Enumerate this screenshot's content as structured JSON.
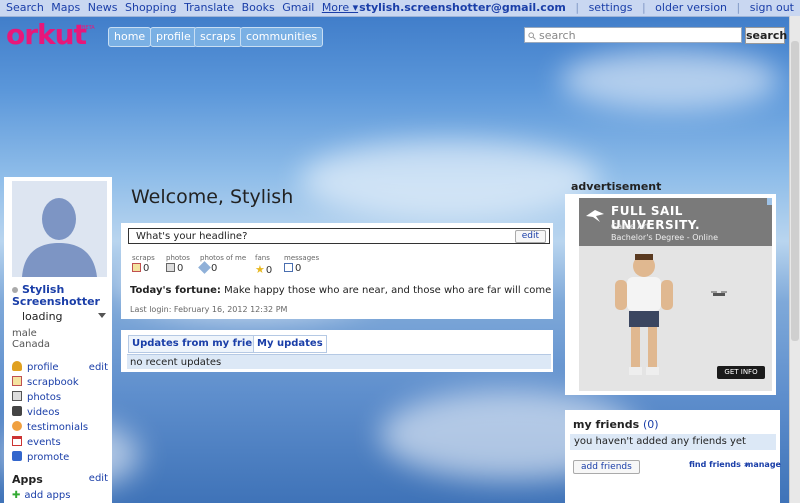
{
  "gbar": {
    "links": [
      "Search",
      "Maps",
      "News",
      "Shopping",
      "Translate",
      "Books",
      "Gmail",
      "More ▾"
    ],
    "email": "stylish.screenshotter@gmail.com",
    "settings": "settings",
    "older_version": "older version",
    "sign_out": "sign out"
  },
  "header": {
    "logo": "orkut",
    "beta": "BETA",
    "nav": [
      "home",
      "profile",
      "scraps",
      "communities"
    ],
    "search_placeholder": "search",
    "search_button": "search"
  },
  "left": {
    "name_line1": "Stylish",
    "name_line2": "Screenshotter",
    "status": "loading",
    "gender": "male",
    "country": "Canada",
    "menu": [
      {
        "label": "profile",
        "icon": "profile-icon",
        "color": "#e0a020"
      },
      {
        "label": "scrapbook",
        "icon": "scrapbook-icon",
        "color": "#c05050"
      },
      {
        "label": "photos",
        "icon": "photos-icon",
        "color": "#555555"
      },
      {
        "label": "videos",
        "icon": "videos-icon",
        "color": "#444444"
      },
      {
        "label": "testimonials",
        "icon": "testimonials-icon",
        "color": "#d07020"
      },
      {
        "label": "events",
        "icon": "events-icon",
        "color": "#cc3333"
      },
      {
        "label": "promote",
        "icon": "promote-icon",
        "color": "#3366cc"
      }
    ],
    "edit": "edit",
    "apps_title": "Apps",
    "apps_edit": "edit",
    "add_apps": "add apps"
  },
  "center": {
    "welcome": "Welcome, Stylish",
    "headline": "What's your headline?",
    "headline_edit": "edit",
    "stats": [
      {
        "label": "scraps",
        "value": "0",
        "icon": "scrap-icon"
      },
      {
        "label": "photos",
        "value": "0",
        "icon": "photo-icon"
      },
      {
        "label": "photos of me",
        "value": "0",
        "icon": "tag-icon"
      },
      {
        "label": "fans",
        "value": "0",
        "icon": "star-icon"
      },
      {
        "label": "messages",
        "value": "0",
        "icon": "envelope-icon"
      }
    ],
    "fortune_label": "Today's fortune:",
    "fortune_text": "Make happy those who are near, and those who are far will come",
    "last_login": "Last login: February 16, 2012 12:32 PM",
    "tabs": [
      "Updates from my friends",
      "My updates"
    ],
    "no_updates": "no recent updates"
  },
  "right": {
    "ad_label": "advertisement",
    "ad_title": "FULL SAIL UNIVERSITY.",
    "ad_sub1": "Game Art",
    "ad_sub2": "Bachelor's Degree - Online",
    "ad_cta": "GET INFO",
    "friends_title": "my friends",
    "friends_count": "(0)",
    "friends_msg": "you haven't added any friends yet",
    "add_friends": "add friends",
    "find_friends": "find friends »",
    "manage": "manage"
  },
  "colors": {
    "brand": "#e8177a",
    "link": "#1a3ea8",
    "gbar": "#c9d7f1"
  }
}
